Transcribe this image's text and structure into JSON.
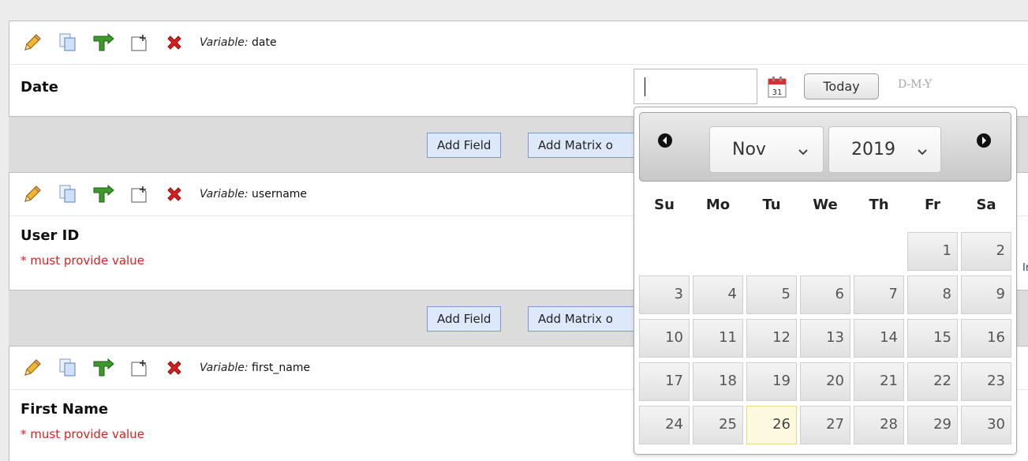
{
  "fields": [
    {
      "variable_prefix": "Variable:",
      "variable_name": "date",
      "label": "Date",
      "required_note": ""
    },
    {
      "variable_prefix": "Variable:",
      "variable_name": "username",
      "label": "User ID",
      "required_note": "* must provide value"
    },
    {
      "variable_prefix": "Variable:",
      "variable_name": "first_name",
      "label": "First Name",
      "required_note": "* must provide value"
    }
  ],
  "toolbar_icons": [
    "pencil-icon",
    "copy-icon",
    "branch-icon",
    "move-icon",
    "delete-icon"
  ],
  "add_bar": {
    "add_field_label": "Add Field",
    "add_matrix_label": "Add Matrix o"
  },
  "date_widget": {
    "input_value": "",
    "today_label": "Today",
    "format_hint": "D-M-Y",
    "right_cut_text": "Ir"
  },
  "datepicker": {
    "month": "Nov",
    "year": "2019",
    "weekdays": [
      "Su",
      "Mo",
      "Tu",
      "We",
      "Th",
      "Fr",
      "Sa"
    ],
    "weeks": [
      [
        "",
        "",
        "",
        "",
        "",
        "1",
        "2"
      ],
      [
        "3",
        "4",
        "5",
        "6",
        "7",
        "8",
        "9"
      ],
      [
        "10",
        "11",
        "12",
        "13",
        "14",
        "15",
        "16"
      ],
      [
        "17",
        "18",
        "19",
        "20",
        "21",
        "22",
        "23"
      ],
      [
        "24",
        "25",
        "26",
        "27",
        "28",
        "29",
        "30"
      ]
    ],
    "today": "26",
    "today_color": "#fdf8e0"
  },
  "colors": {
    "required": "#e02020",
    "add_button_bg": "#dde9fa",
    "add_button_border": "#7b9bd1"
  }
}
